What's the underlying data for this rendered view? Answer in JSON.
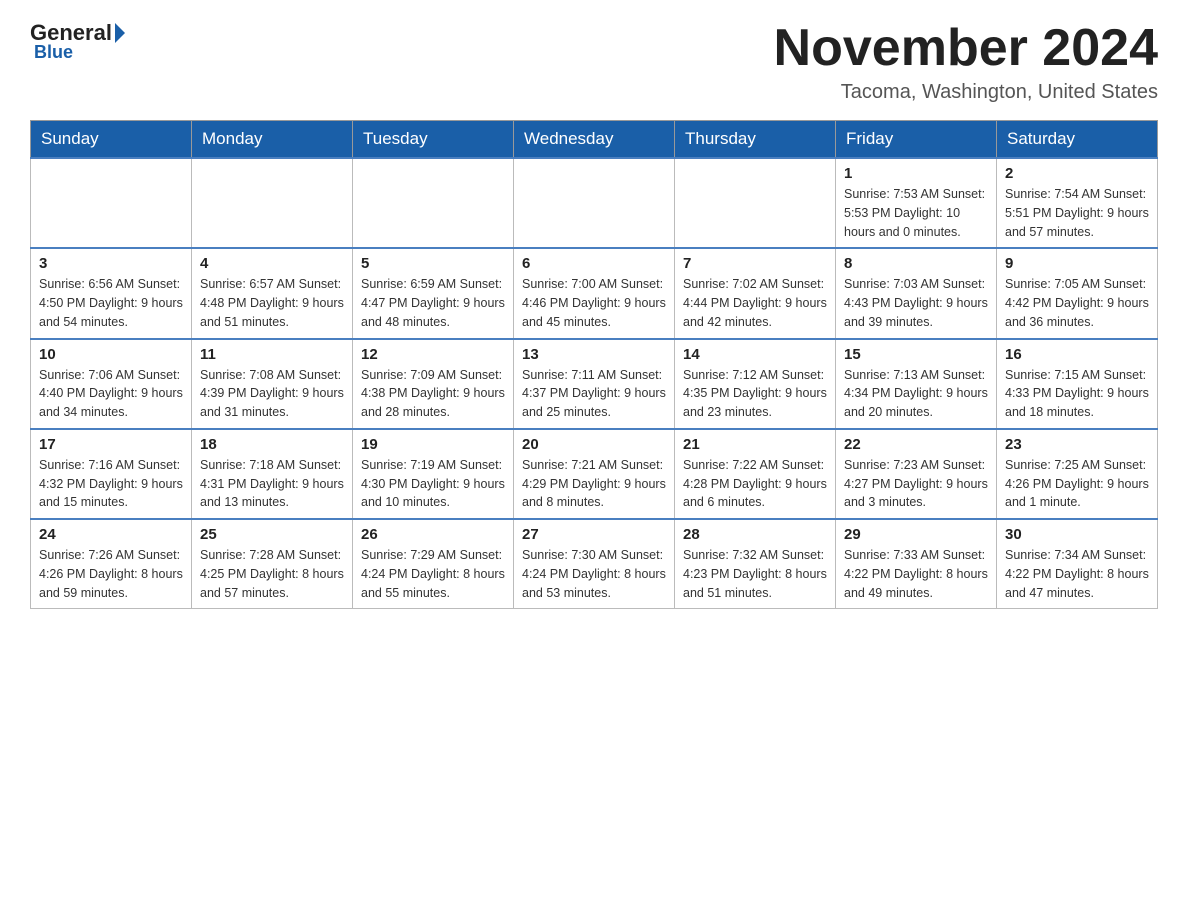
{
  "header": {
    "logo": {
      "brand": "General",
      "brand_colored": "Blue"
    },
    "title": "November 2024",
    "subtitle": "Tacoma, Washington, United States"
  },
  "calendar": {
    "days_of_week": [
      "Sunday",
      "Monday",
      "Tuesday",
      "Wednesday",
      "Thursday",
      "Friday",
      "Saturday"
    ],
    "weeks": [
      [
        {
          "day": "",
          "info": ""
        },
        {
          "day": "",
          "info": ""
        },
        {
          "day": "",
          "info": ""
        },
        {
          "day": "",
          "info": ""
        },
        {
          "day": "",
          "info": ""
        },
        {
          "day": "1",
          "info": "Sunrise: 7:53 AM\nSunset: 5:53 PM\nDaylight: 10 hours\nand 0 minutes."
        },
        {
          "day": "2",
          "info": "Sunrise: 7:54 AM\nSunset: 5:51 PM\nDaylight: 9 hours\nand 57 minutes."
        }
      ],
      [
        {
          "day": "3",
          "info": "Sunrise: 6:56 AM\nSunset: 4:50 PM\nDaylight: 9 hours\nand 54 minutes."
        },
        {
          "day": "4",
          "info": "Sunrise: 6:57 AM\nSunset: 4:48 PM\nDaylight: 9 hours\nand 51 minutes."
        },
        {
          "day": "5",
          "info": "Sunrise: 6:59 AM\nSunset: 4:47 PM\nDaylight: 9 hours\nand 48 minutes."
        },
        {
          "day": "6",
          "info": "Sunrise: 7:00 AM\nSunset: 4:46 PM\nDaylight: 9 hours\nand 45 minutes."
        },
        {
          "day": "7",
          "info": "Sunrise: 7:02 AM\nSunset: 4:44 PM\nDaylight: 9 hours\nand 42 minutes."
        },
        {
          "day": "8",
          "info": "Sunrise: 7:03 AM\nSunset: 4:43 PM\nDaylight: 9 hours\nand 39 minutes."
        },
        {
          "day": "9",
          "info": "Sunrise: 7:05 AM\nSunset: 4:42 PM\nDaylight: 9 hours\nand 36 minutes."
        }
      ],
      [
        {
          "day": "10",
          "info": "Sunrise: 7:06 AM\nSunset: 4:40 PM\nDaylight: 9 hours\nand 34 minutes."
        },
        {
          "day": "11",
          "info": "Sunrise: 7:08 AM\nSunset: 4:39 PM\nDaylight: 9 hours\nand 31 minutes."
        },
        {
          "day": "12",
          "info": "Sunrise: 7:09 AM\nSunset: 4:38 PM\nDaylight: 9 hours\nand 28 minutes."
        },
        {
          "day": "13",
          "info": "Sunrise: 7:11 AM\nSunset: 4:37 PM\nDaylight: 9 hours\nand 25 minutes."
        },
        {
          "day": "14",
          "info": "Sunrise: 7:12 AM\nSunset: 4:35 PM\nDaylight: 9 hours\nand 23 minutes."
        },
        {
          "day": "15",
          "info": "Sunrise: 7:13 AM\nSunset: 4:34 PM\nDaylight: 9 hours\nand 20 minutes."
        },
        {
          "day": "16",
          "info": "Sunrise: 7:15 AM\nSunset: 4:33 PM\nDaylight: 9 hours\nand 18 minutes."
        }
      ],
      [
        {
          "day": "17",
          "info": "Sunrise: 7:16 AM\nSunset: 4:32 PM\nDaylight: 9 hours\nand 15 minutes."
        },
        {
          "day": "18",
          "info": "Sunrise: 7:18 AM\nSunset: 4:31 PM\nDaylight: 9 hours\nand 13 minutes."
        },
        {
          "day": "19",
          "info": "Sunrise: 7:19 AM\nSunset: 4:30 PM\nDaylight: 9 hours\nand 10 minutes."
        },
        {
          "day": "20",
          "info": "Sunrise: 7:21 AM\nSunset: 4:29 PM\nDaylight: 9 hours\nand 8 minutes."
        },
        {
          "day": "21",
          "info": "Sunrise: 7:22 AM\nSunset: 4:28 PM\nDaylight: 9 hours\nand 6 minutes."
        },
        {
          "day": "22",
          "info": "Sunrise: 7:23 AM\nSunset: 4:27 PM\nDaylight: 9 hours\nand 3 minutes."
        },
        {
          "day": "23",
          "info": "Sunrise: 7:25 AM\nSunset: 4:26 PM\nDaylight: 9 hours\nand 1 minute."
        }
      ],
      [
        {
          "day": "24",
          "info": "Sunrise: 7:26 AM\nSunset: 4:26 PM\nDaylight: 8 hours\nand 59 minutes."
        },
        {
          "day": "25",
          "info": "Sunrise: 7:28 AM\nSunset: 4:25 PM\nDaylight: 8 hours\nand 57 minutes."
        },
        {
          "day": "26",
          "info": "Sunrise: 7:29 AM\nSunset: 4:24 PM\nDaylight: 8 hours\nand 55 minutes."
        },
        {
          "day": "27",
          "info": "Sunrise: 7:30 AM\nSunset: 4:24 PM\nDaylight: 8 hours\nand 53 minutes."
        },
        {
          "day": "28",
          "info": "Sunrise: 7:32 AM\nSunset: 4:23 PM\nDaylight: 8 hours\nand 51 minutes."
        },
        {
          "day": "29",
          "info": "Sunrise: 7:33 AM\nSunset: 4:22 PM\nDaylight: 8 hours\nand 49 minutes."
        },
        {
          "day": "30",
          "info": "Sunrise: 7:34 AM\nSunset: 4:22 PM\nDaylight: 8 hours\nand 47 minutes."
        }
      ]
    ]
  }
}
